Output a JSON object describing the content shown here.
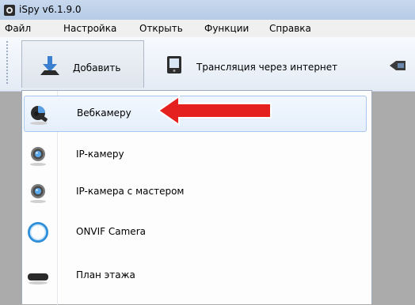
{
  "window": {
    "title": "iSpy v6.1.9.0",
    "icon": "webcam-app-icon"
  },
  "menubar": {
    "items": [
      "Файл",
      "Настройка",
      "Открыть",
      "Функции",
      "Справка"
    ]
  },
  "toolbar": {
    "add_label": "Добавить",
    "broadcast_label": "Трансляция через интернет"
  },
  "dropdown": {
    "items": [
      {
        "label": "Вебкамеру",
        "icon": "webcam-icon"
      },
      {
        "label": "IP-камеру",
        "icon": "ip-camera-icon"
      },
      {
        "label": "IP-камера с мастером",
        "icon": "ip-camera-wizard-icon"
      },
      {
        "label": "ONVIF Camera",
        "icon": "onvif-camera-icon"
      },
      {
        "label": "План этажа",
        "icon": "floor-plan-icon"
      }
    ]
  },
  "colors": {
    "arrow": "#e4211e",
    "selection_border": "#a8c7ec"
  }
}
